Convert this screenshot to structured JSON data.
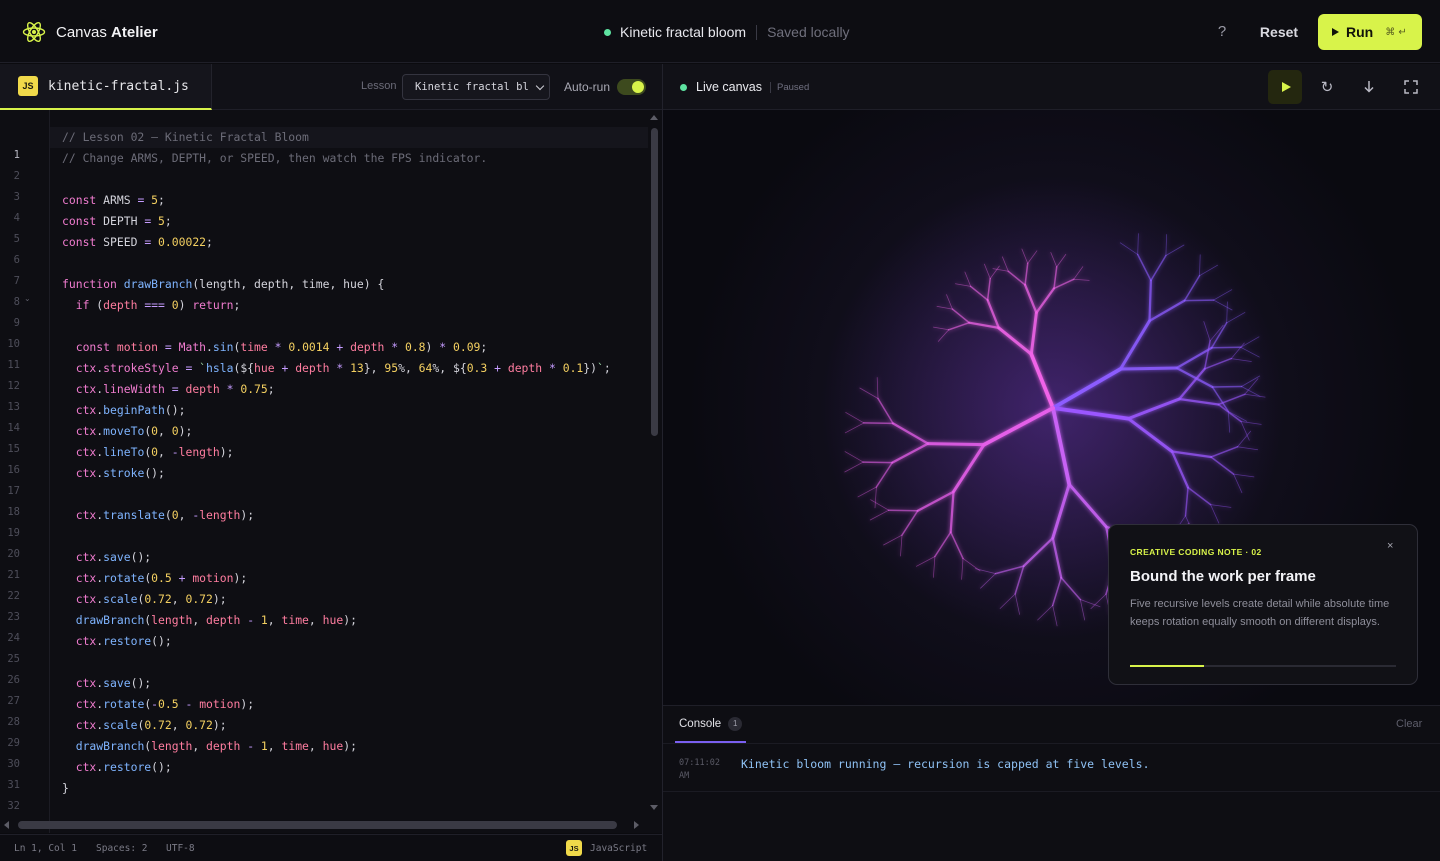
{
  "app": {
    "brand_prefix": "Canvas",
    "brand_bold": "Atelier",
    "project_title": "Kinetic fractal bloom",
    "save_status": "Saved locally",
    "help_label": "?",
    "reset_label": "Reset",
    "run_label": "Run",
    "run_shortcut": "⌘ ↵",
    "accent": "#d8f34a"
  },
  "editor": {
    "file_badge": "JS",
    "file_name": "kinetic-fractal.js",
    "lesson_label": "Lesson",
    "lesson_value": "Kinetic fractal bl",
    "autorun_label": "Auto-run",
    "autorun_on": true,
    "line_numbers": [
      "1",
      "2",
      "3",
      "4",
      "5",
      "6",
      "7",
      "8",
      "9",
      "10",
      "11",
      "12",
      "13",
      "14",
      "15",
      "16",
      "17",
      "18",
      "19",
      "20",
      "21",
      "22",
      "23",
      "24",
      "25",
      "26",
      "27",
      "28",
      "29",
      "30",
      "31",
      "32"
    ],
    "code": [
      "// Lesson 02 — Kinetic Fractal Bloom",
      "// Change ARMS, DEPTH, or SPEED, then watch the FPS indicator.",
      "",
      "const ARMS = 5;",
      "const DEPTH = 5;",
      "const SPEED = 0.00022;",
      "",
      "function drawBranch(length, depth, time, hue) {",
      "  if (depth === 0) return;",
      "",
      "  const motion = Math.sin(time * 0.0014 + depth * 0.8) * 0.09;",
      "  ctx.strokeStyle = `hsla(${hue + depth * 13}, 95%, 64%, ${0.3 + depth * 0.1})`;",
      "  ctx.lineWidth = depth * 0.75;",
      "  ctx.beginPath();",
      "  ctx.moveTo(0, 0);",
      "  ctx.lineTo(0, -length);",
      "  ctx.stroke();",
      "",
      "  ctx.translate(0, -length);",
      "",
      "  ctx.save();",
      "  ctx.rotate(0.5 + motion);",
      "  ctx.scale(0.72, 0.72);",
      "  drawBranch(length, depth - 1, time, hue);",
      "  ctx.restore();",
      "",
      "  ctx.save();",
      "  ctx.rotate(-0.5 - motion);",
      "  ctx.scale(0.72, 0.72);",
      "  drawBranch(length, depth - 1, time, hue);",
      "  ctx.restore();",
      "}"
    ],
    "status": {
      "position": "Ln 1, Col 1",
      "spaces": "Spaces: 2",
      "encoding": "UTF-8",
      "lang_badge": "JS",
      "language": "JavaScript"
    }
  },
  "canvas": {
    "title": "Live canvas",
    "state": "Paused",
    "icons": [
      "play-icon",
      "refresh-icon",
      "download-icon",
      "fullscreen-icon"
    ]
  },
  "note": {
    "kicker": "CREATIVE CODING NOTE · 02",
    "title": "Bound the work per frame",
    "body": "Five recursive levels create detail while absolute time keeps rotation equally smooth on different displays.",
    "close_label": "×",
    "progress": 0.28
  },
  "console": {
    "tab_label": "Console",
    "count": "1",
    "clear_label": "Clear",
    "entries": [
      {
        "time": "07:11:02 AM",
        "message": "Kinetic bloom running — recursion is capped at five levels."
      }
    ]
  }
}
